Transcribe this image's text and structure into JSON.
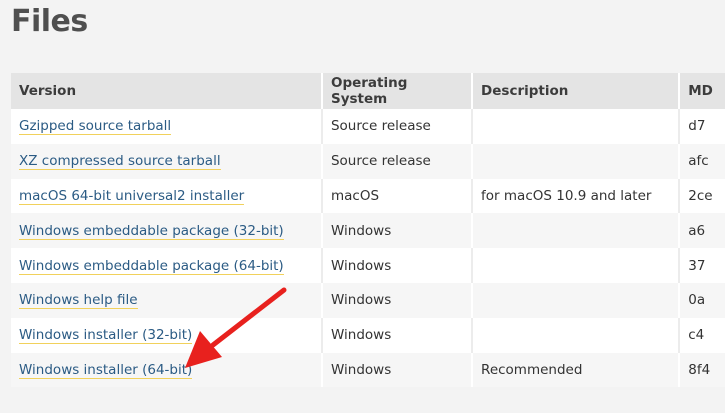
{
  "page": {
    "title": "Files"
  },
  "table": {
    "headers": {
      "version": "Version",
      "os": "Operating System",
      "description": "Description",
      "md5": "MD"
    },
    "rows": [
      {
        "version": "Gzipped source tarball",
        "os": "Source release",
        "description": "",
        "md5": "d7"
      },
      {
        "version": "XZ compressed source tarball",
        "os": "Source release",
        "description": "",
        "md5": "afc"
      },
      {
        "version": "macOS 64-bit universal2 installer",
        "os": "macOS",
        "description": "for macOS 10.9 and later",
        "md5": "2ce"
      },
      {
        "version": "Windows embeddable package (32-bit)",
        "os": "Windows",
        "description": "",
        "md5": "a6"
      },
      {
        "version": "Windows embeddable package (64-bit)",
        "os": "Windows",
        "description": "",
        "md5": "37"
      },
      {
        "version": "Windows help file",
        "os": "Windows",
        "description": "",
        "md5": "0a"
      },
      {
        "version": "Windows installer (32-bit)",
        "os": "Windows",
        "description": "",
        "md5": "c4"
      },
      {
        "version": "Windows installer (64-bit)",
        "os": "Windows",
        "description": "Recommended",
        "md5": "8f4"
      }
    ]
  },
  "colors": {
    "link": "#2b5b84",
    "link_underline": "#f1d15b",
    "header_bg": "#e4e4e4",
    "arrow": "#e8211e"
  }
}
